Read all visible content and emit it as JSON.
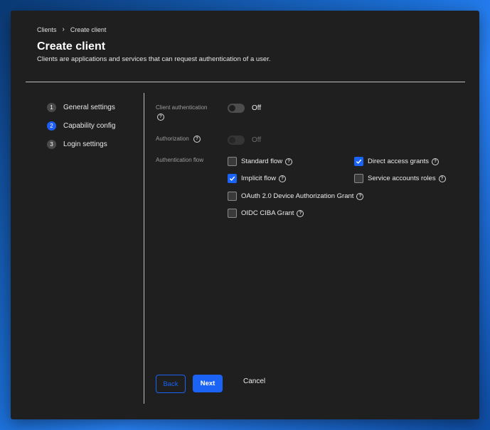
{
  "breadcrumb": {
    "parent": "Clients",
    "separator": "›",
    "current": "Create client"
  },
  "page": {
    "title": "Create client",
    "subtitle": "Clients are applications and services that can request authentication of a user."
  },
  "steps": [
    {
      "number": "1",
      "label": "General settings"
    },
    {
      "number": "2",
      "label": "Capability config",
      "active": true
    },
    {
      "number": "3",
      "label": "Login settings"
    }
  ],
  "form": {
    "client_authentication": {
      "label": "Client authentication",
      "value": "Off"
    },
    "authorization": {
      "label": "Authorization",
      "value": "Off"
    },
    "authentication_flow": {
      "label": "Authentication flow",
      "options": [
        {
          "label": "Standard flow",
          "checked": false
        },
        {
          "label": "Direct access grants",
          "checked": true
        },
        {
          "label": "Implicit flow",
          "checked": true
        },
        {
          "label": "Service accounts roles",
          "checked": false
        },
        {
          "label": "OAuth 2.0 Device Authorization Grant",
          "checked": false
        },
        {
          "label": "OIDC CIBA Grant",
          "checked": false
        }
      ]
    }
  },
  "buttons": {
    "back": "Back",
    "next": "Next",
    "cancel": "Cancel"
  },
  "help_glyph": "?",
  "colors": {
    "accent": "#1a63f5",
    "background": "#1f1f1f"
  }
}
